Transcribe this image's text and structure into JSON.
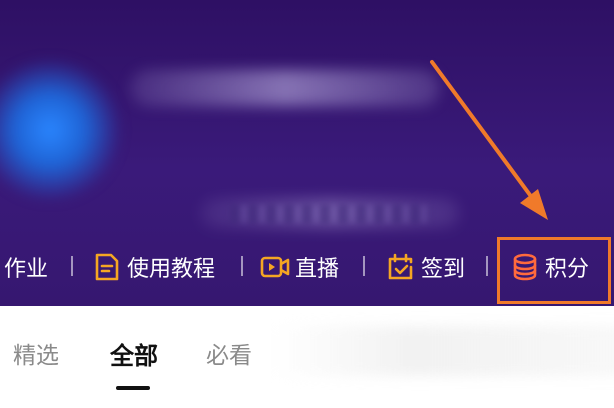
{
  "toolbar": {
    "items": [
      {
        "label": "作业",
        "icon": "none"
      },
      {
        "label": "使用教程",
        "icon": "document-icon"
      },
      {
        "label": "直播",
        "icon": "video-camera-icon"
      },
      {
        "label": "签到",
        "icon": "calendar-check-icon"
      },
      {
        "label": "积分",
        "icon": "coin-stack-icon"
      }
    ],
    "icon_color": "#f5a623",
    "points_icon_color": "#ff6a3d"
  },
  "annotation": {
    "color": "#f07a2a"
  },
  "tabs": {
    "items": [
      {
        "label": "精选",
        "active": false
      },
      {
        "label": "全部",
        "active": true
      },
      {
        "label": "必看",
        "active": false
      }
    ]
  },
  "colors": {
    "header_bg": "#341570",
    "tab_text": "#8a8a8a",
    "tab_active": "#111111"
  }
}
